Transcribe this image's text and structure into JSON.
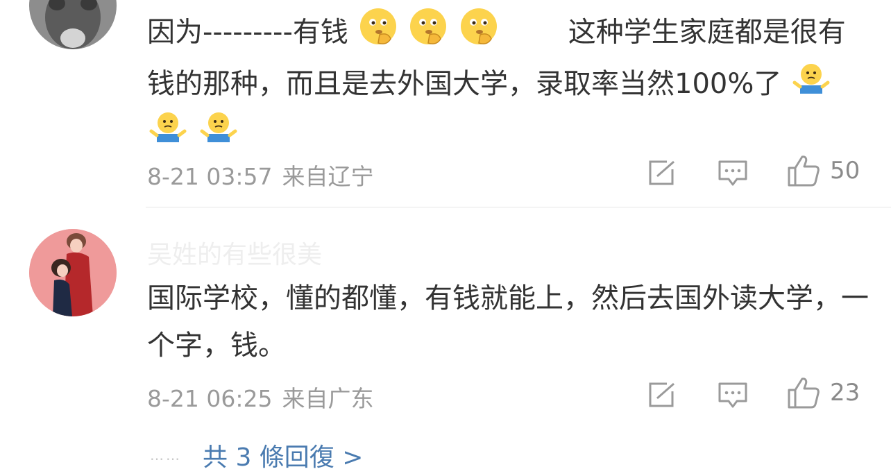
{
  "comments": [
    {
      "username": "",
      "text_part1": "因为---------有钱",
      "text_part2": "这种学生家庭都是很有钱的那种，而且是去外国大学，录取率当然100%了",
      "emoji_a": "thinking-emoji",
      "emoji_b": "shrug-emoji",
      "date": "8-21 03:57",
      "location": "来自辽宁",
      "likes": "50"
    },
    {
      "username": "吴姓的有些很美",
      "text": "国际学校，懂的都懂，有钱就能上，然后去国外读大学，一个字，钱。",
      "date": "8-21 06:25",
      "location": "来自广东",
      "likes": "23"
    }
  ],
  "more": {
    "dots": "……",
    "label": "共 3 條回復 >"
  },
  "colors": {
    "text": "#333333",
    "meta": "#9a9a9a",
    "link": "#4a7bb0",
    "divider": "#e6e6e6"
  }
}
